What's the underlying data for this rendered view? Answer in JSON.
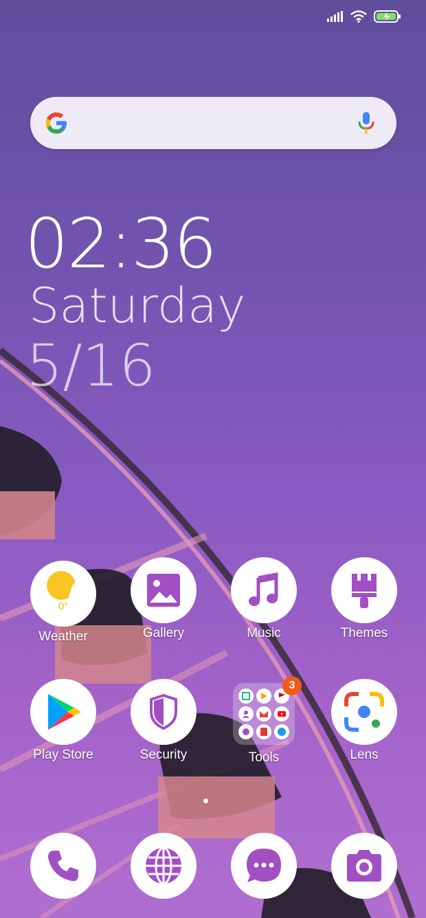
{
  "colors": {
    "accent": "#a14fc3",
    "background_top": "#5f4e9c",
    "background_bottom": "#b06ed0",
    "badge": "#f25a1a"
  },
  "status_bar": {
    "icons": [
      "signal-icon",
      "wifi-icon",
      "battery-charging-icon"
    ]
  },
  "search": {
    "icon_left": "google-g-icon",
    "icon_right": "microphone-icon"
  },
  "clock": {
    "time": "02:36",
    "day": "Saturday",
    "date": "5/16"
  },
  "apps": {
    "weather": {
      "label": "Weather",
      "temp": "0°"
    },
    "gallery": {
      "label": "Gallery"
    },
    "music": {
      "label": "Music"
    },
    "themes": {
      "label": "Themes"
    },
    "play_store": {
      "label": "Play Store"
    },
    "security": {
      "label": "Security"
    },
    "tools": {
      "label": "Tools",
      "badge": "3"
    },
    "lens": {
      "label": "Lens"
    }
  },
  "dock": [
    "phone-icon",
    "browser-icon",
    "messages-icon",
    "camera-icon"
  ],
  "page_indicator": {
    "pages": 1,
    "current": 1
  }
}
